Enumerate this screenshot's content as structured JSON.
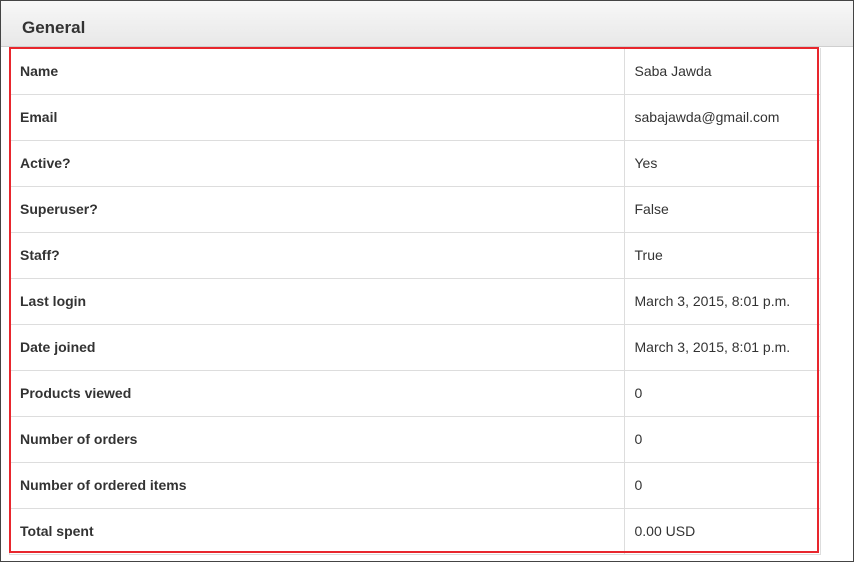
{
  "panel": {
    "title": "General"
  },
  "rows": [
    {
      "label": "Name",
      "value": "Saba Jawda"
    },
    {
      "label": "Email",
      "value": "sabajawda@gmail.com"
    },
    {
      "label": "Active?",
      "value": "Yes"
    },
    {
      "label": "Superuser?",
      "value": "False"
    },
    {
      "label": "Staff?",
      "value": "True"
    },
    {
      "label": "Last login",
      "value": "March 3, 2015, 8:01 p.m."
    },
    {
      "label": "Date joined",
      "value": "March 3, 2015, 8:01 p.m."
    },
    {
      "label": "Products viewed",
      "value": "0"
    },
    {
      "label": "Number of orders",
      "value": "0"
    },
    {
      "label": "Number of ordered items",
      "value": "0"
    },
    {
      "label": "Total spent",
      "value": "0.00 USD"
    }
  ],
  "colors": {
    "highlight_border": "#e8262d",
    "row_border": "#dddddd",
    "header_bg": "#eeeeee"
  }
}
